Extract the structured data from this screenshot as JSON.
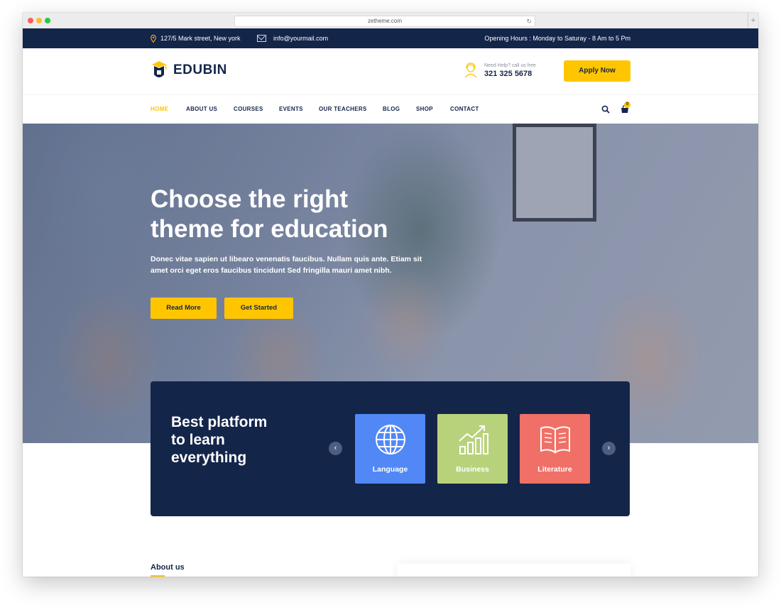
{
  "browser": {
    "url": "zetheme.com"
  },
  "topbar": {
    "address": "127/5 Mark street, New york",
    "email": "info@yourmail.com",
    "hours": "Opening Hours : Monday to Saturay - 8 Am to 5 Pm"
  },
  "header": {
    "logo_text": "EDUBIN",
    "help_label": "Need Help? call us free",
    "help_phone": "321 325 5678",
    "apply_label": "Apply Now"
  },
  "nav": {
    "items": [
      {
        "label": "HOME",
        "active": true
      },
      {
        "label": "ABOUT US"
      },
      {
        "label": "COURSES"
      },
      {
        "label": "EVENTS"
      },
      {
        "label": "OUR TEACHERS"
      },
      {
        "label": "BLOG"
      },
      {
        "label": "SHOP"
      },
      {
        "label": "CONTACT"
      }
    ],
    "cart_count": "0"
  },
  "hero": {
    "title_line1": "Choose the right",
    "title_line2": "theme for education",
    "text": "Donec vitae sapien ut libearo venenatis faucibus. Nullam quis ante. Etiam sit amet orci eget eros faucibus tincidunt Sed fringilla mauri amet nibh.",
    "read_more": "Read More",
    "get_started": "Get Started"
  },
  "categories": {
    "title_line1": "Best platform",
    "title_line2": "to learn",
    "title_line3": "everything",
    "items": [
      {
        "label": "Language",
        "icon": "globe-icon",
        "color": "#5188f5"
      },
      {
        "label": "Business",
        "icon": "growth-chart-icon",
        "color": "#b8d27c"
      },
      {
        "label": "Literature",
        "icon": "book-icon",
        "color": "#f07067"
      }
    ]
  },
  "about": {
    "label": "About us"
  },
  "colors": {
    "navy": "#14254a",
    "accent": "#ffc600"
  }
}
